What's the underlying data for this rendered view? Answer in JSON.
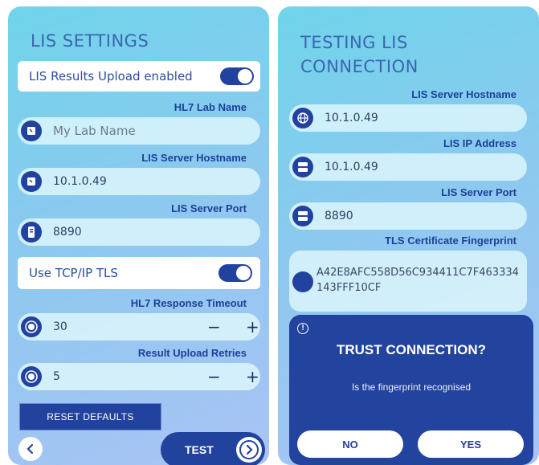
{
  "left": {
    "title": "LIS SETTINGS",
    "upload_label": "LIS Results Upload enabled",
    "hl7_lab_name_label": "HL7 Lab Name",
    "hl7_lab_name_placeholder": "My Lab Name",
    "server_hostname_label": "LIS Server Hostname",
    "server_hostname_value": "10.1.0.49",
    "server_port_label": "LIS Server Port",
    "server_port_value": "8890",
    "tls_label": "Use TCP/IP TLS",
    "response_timeout_label": "HL7 Response Timeout",
    "response_timeout_value": "30",
    "upload_retries_label": "Result Upload Retries",
    "upload_retries_value": "5",
    "minus": "−",
    "plus": "+",
    "reset_label": "RESET DEFAULTS",
    "test_label": "TEST"
  },
  "right": {
    "title_line1": "TESTING LIS",
    "title_line2": "CONNECTION",
    "hostname_label": "LIS Server Hostname",
    "hostname_value": "10.1.0.49",
    "ip_label": "LIS IP Address",
    "ip_value": "10.1.0.49",
    "port_label": "LIS Server Port",
    "port_value": "8890",
    "fingerprint_label": "TLS Certificate Fingerprint",
    "fingerprint_value": "A42E8AFC558D56C934411C7F463334143FFF10CF"
  },
  "dialog": {
    "title": "TRUST CONNECTION?",
    "message": "Is the fingerprint recognised",
    "no_label": "NO",
    "yes_label": "YES"
  },
  "colors": {
    "accent": "#2242a0",
    "panel_gradient_start": "#6fd4ea",
    "panel_gradient_end": "#aac3f5"
  },
  "icons": [
    "tablet-icon",
    "server-phone-icon",
    "timer-icon",
    "globe-icon",
    "server-icon",
    "chevron-left-icon",
    "chevron-right-icon",
    "info-icon"
  ]
}
